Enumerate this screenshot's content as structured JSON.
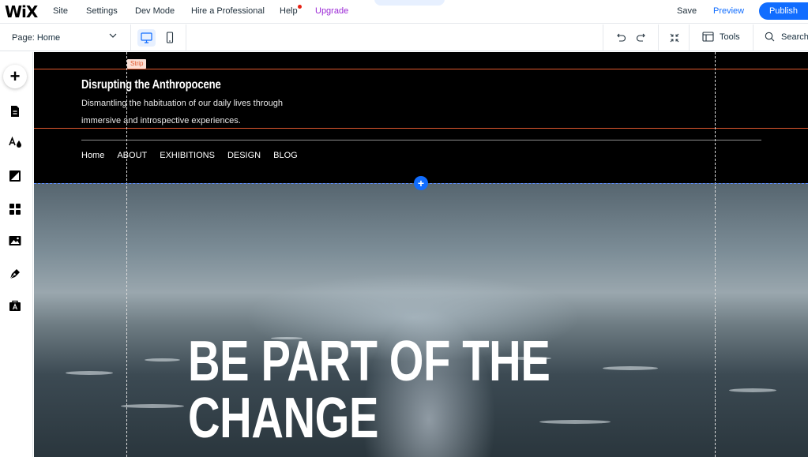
{
  "topbar": {
    "logo": "WiX",
    "menu": {
      "site": "Site",
      "settings": "Settings",
      "dev_mode": "Dev Mode",
      "hire": "Hire a Professional",
      "help": "Help",
      "upgrade": "Upgrade"
    },
    "save": "Save",
    "preview": "Preview",
    "publish": "Publish",
    "colors": {
      "accent": "#116dff",
      "upgrade": "#9a27d5",
      "notification": "#e62214"
    }
  },
  "subbar": {
    "page_prefix": "Page:",
    "page_name": "Home",
    "tools": "Tools",
    "search": "Search"
  },
  "sidebar": {
    "items": [
      {
        "icon": "add-icon"
      },
      {
        "icon": "pages-icon"
      },
      {
        "icon": "design-icon"
      },
      {
        "icon": "background-icon"
      },
      {
        "icon": "apps-icon"
      },
      {
        "icon": "media-icon"
      },
      {
        "icon": "blog-pen-icon"
      },
      {
        "icon": "business-icon"
      }
    ]
  },
  "site": {
    "strip_label": "Strip",
    "title": "Disrupting the Anthropocene",
    "subtitle_line1": "Dismantling the habituation of our daily lives through",
    "subtitle_line2": "immersive and introspective experiences.",
    "nav": [
      "Home",
      "ABOUT",
      "EXHIBITIONS",
      "DESIGN",
      "BLOG"
    ],
    "hero_heading_line1": "BE PART OF THE",
    "hero_heading_line2": "CHANGE",
    "add_section": "+"
  }
}
